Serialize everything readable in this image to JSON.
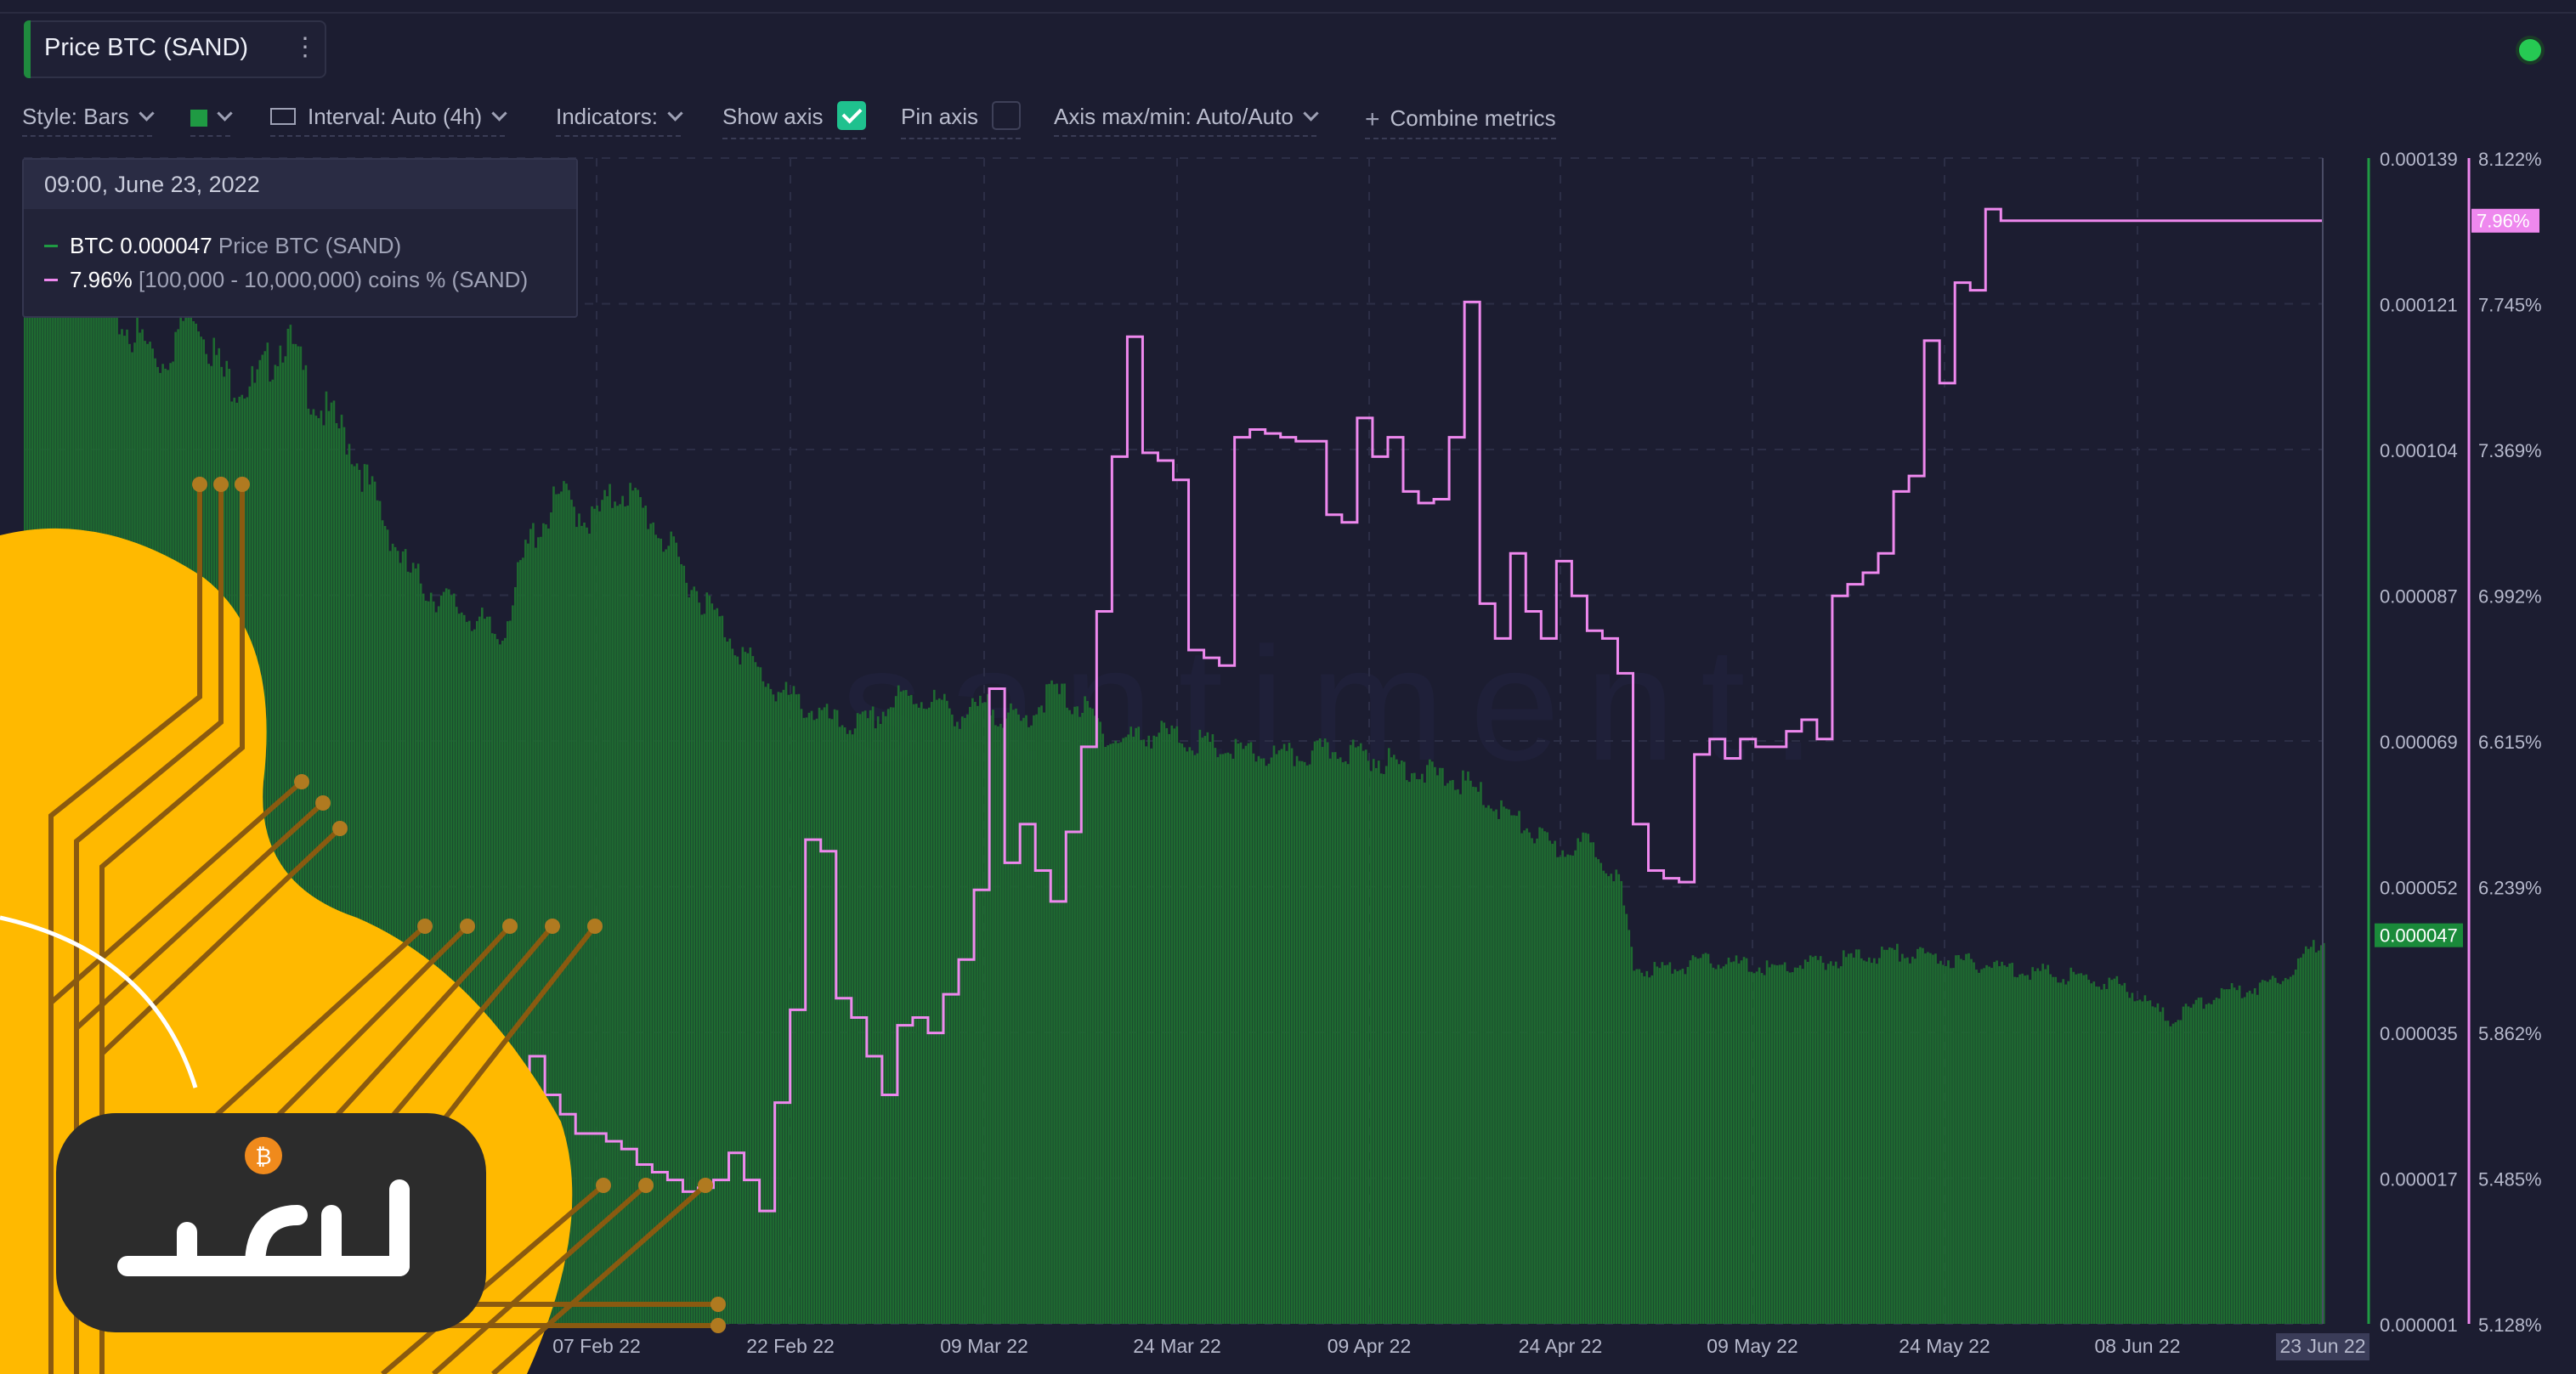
{
  "metric": {
    "label": "Price BTC (SAND)"
  },
  "toolbar": {
    "style_label": "Style: Bars",
    "interval_label": "Interval: Auto (4h)",
    "indicators_label": "Indicators:",
    "show_axis_label": "Show axis",
    "show_axis_checked": true,
    "pin_axis_label": "Pin axis",
    "pin_axis_checked": false,
    "axis_minmax_label": "Axis max/min: Auto/Auto",
    "combine_label": "Combine metrics"
  },
  "colors": {
    "price": "#1e6b30",
    "price_label_bg": "#1a8a3a",
    "supply": "#ee88ee",
    "background": "#1c1d31"
  },
  "tooltip": {
    "date": "09:00, June 23, 2022",
    "rows": [
      {
        "value": "BTC 0.000047",
        "name": "Price BTC (SAND)",
        "color": "#1f9a43"
      },
      {
        "value": "7.96%",
        "name": "[100,000  - 10,000,000) coins % (SAND)",
        "color": "#ee88ee"
      }
    ]
  },
  "watermark": "santiment.",
  "logo_text": "انتخاب",
  "icons": [
    "kebab-icon",
    "chevron-down-icon",
    "ruler-icon",
    "check-icon",
    "plus-icon",
    "status-dot-icon"
  ],
  "chart_data": {
    "type": "bar",
    "x_labels": [
      "07 Feb 22",
      "22 Feb 22",
      "09 Mar 22",
      "24 Mar 22",
      "09 Apr 22",
      "24 Apr 22",
      "09 May 22",
      "24 May 22",
      "08 Jun 22",
      "23 Jun 22"
    ],
    "hover_x_label": "23 Jun 22",
    "y_left": {
      "ticks": [
        "0.000139",
        "0.000121",
        "0.000104",
        "0.000087",
        "0.000069",
        "0.000052",
        "0.000035",
        "0.000017",
        "0.000001"
      ],
      "range": [
        1e-06,
        0.000139
      ],
      "current": "0.000047"
    },
    "y_right": {
      "ticks": [
        "8.122%",
        "7.745%",
        "7.369%",
        "6.992%",
        "6.615%",
        "6.239%",
        "5.862%",
        "5.485%",
        "5.128%"
      ],
      "range": [
        5.108,
        8.122
      ],
      "current": "7.96%"
    },
    "series": [
      {
        "name": "Price BTC (SAND)",
        "kind": "bar",
        "points": [
          [
            "2022-01-24",
            0.000128
          ],
          [
            "2022-01-27",
            0.000126
          ],
          [
            "2022-01-30",
            0.00012
          ],
          [
            "2022-02-02",
            0.000115
          ],
          [
            "2022-02-04",
            0.000122
          ],
          [
            "2022-02-06",
            0.000113
          ],
          [
            "2022-02-08",
            0.000112
          ],
          [
            "2022-02-10",
            0.000118
          ],
          [
            "2022-02-12",
            0.00011
          ],
          [
            "2022-02-14",
            0.000106
          ],
          [
            "2022-02-16",
            9.8e-05
          ],
          [
            "2022-02-18",
            9e-05
          ],
          [
            "2022-02-20",
            8.7e-05
          ],
          [
            "2022-02-22",
            8.5e-05
          ],
          [
            "2022-02-24",
            8.2e-05
          ],
          [
            "2022-02-26",
            9.4e-05
          ],
          [
            "2022-02-28",
            9.9e-05
          ],
          [
            "2022-03-02",
            9.6e-05
          ],
          [
            "2022-03-04",
            0.0001
          ],
          [
            "2022-03-06",
            9.6e-05
          ],
          [
            "2022-03-08",
            9e-05
          ],
          [
            "2022-03-10",
            8.5e-05
          ],
          [
            "2022-03-12",
            8e-05
          ],
          [
            "2022-03-14",
            7.6e-05
          ],
          [
            "2022-03-16",
            7.4e-05
          ],
          [
            "2022-03-18",
            7.2e-05
          ],
          [
            "2022-03-20",
            7.2e-05
          ],
          [
            "2022-03-22",
            7.5e-05
          ],
          [
            "2022-03-24",
            7.5e-05
          ],
          [
            "2022-03-26",
            7.3e-05
          ],
          [
            "2022-03-28",
            7.4e-05
          ],
          [
            "2022-03-30",
            7.2e-05
          ],
          [
            "2022-04-01",
            7.6e-05
          ],
          [
            "2022-04-03",
            7.4e-05
          ],
          [
            "2022-04-05",
            7e-05
          ],
          [
            "2022-04-08",
            7.1e-05
          ],
          [
            "2022-04-12",
            6.9e-05
          ],
          [
            "2022-04-16",
            6.8e-05
          ],
          [
            "2022-04-20",
            6.9e-05
          ],
          [
            "2022-04-24",
            6.7e-05
          ],
          [
            "2022-04-28",
            6.5e-05
          ],
          [
            "2022-05-01",
            6.1e-05
          ],
          [
            "2022-05-04",
            5.7e-05
          ],
          [
            "2022-05-06",
            5.8e-05
          ],
          [
            "2022-05-08",
            5.4e-05
          ],
          [
            "2022-05-09",
            4.3e-05
          ],
          [
            "2022-05-11",
            4.3e-05
          ],
          [
            "2022-05-14",
            4.4e-05
          ],
          [
            "2022-05-18",
            4.3e-05
          ],
          [
            "2022-05-22",
            4.4e-05
          ],
          [
            "2022-05-26",
            4.5e-05
          ],
          [
            "2022-05-30",
            4.4e-05
          ],
          [
            "2022-06-03",
            4.3e-05
          ],
          [
            "2022-06-07",
            4.2e-05
          ],
          [
            "2022-06-10",
            4.1e-05
          ],
          [
            "2022-06-13",
            3.7e-05
          ],
          [
            "2022-06-16",
            4e-05
          ],
          [
            "2022-06-19",
            4.1e-05
          ],
          [
            "2022-06-21",
            4.3e-05
          ],
          [
            "2022-06-23",
            4.7e-05
          ]
        ]
      },
      {
        "name": "[100,000  - 10,000,000) coins % (SAND)",
        "kind": "step-line",
        "points": [
          [
            "2022-01-24",
            5.6
          ],
          [
            "2022-01-26",
            5.75
          ],
          [
            "2022-01-28",
            5.9
          ],
          [
            "2022-01-30",
            6.03
          ],
          [
            "2022-02-01",
            5.9
          ],
          [
            "2022-02-03",
            5.85
          ],
          [
            "2022-02-05",
            6.26
          ],
          [
            "2022-02-07",
            6.25
          ],
          [
            "2022-02-08",
            6.0
          ],
          [
            "2022-02-09",
            5.9
          ],
          [
            "2022-02-10",
            5.7
          ],
          [
            "2022-02-11",
            5.6
          ],
          [
            "2022-02-12",
            5.5
          ],
          [
            "2022-02-13",
            5.7
          ],
          [
            "2022-02-14",
            5.6
          ],
          [
            "2022-02-15",
            5.9
          ],
          [
            "2022-02-16",
            5.8
          ],
          [
            "2022-02-17",
            5.5
          ],
          [
            "2022-02-18",
            5.74
          ],
          [
            "2022-02-19",
            5.7
          ],
          [
            "2022-02-20",
            5.75
          ],
          [
            "2022-02-21",
            5.5
          ],
          [
            "2022-02-22",
            5.6
          ],
          [
            "2022-02-23",
            5.75
          ],
          [
            "2022-02-24",
            5.7
          ],
          [
            "2022-02-25",
            5.5
          ],
          [
            "2022-02-26",
            5.8
          ],
          [
            "2022-02-27",
            5.7
          ],
          [
            "2022-02-28",
            5.65
          ],
          [
            "2022-03-01",
            5.6
          ],
          [
            "2022-03-02",
            5.6
          ],
          [
            "2022-03-03",
            5.58
          ],
          [
            "2022-03-04",
            5.56
          ],
          [
            "2022-03-05",
            5.52
          ],
          [
            "2022-03-06",
            5.5
          ],
          [
            "2022-03-07",
            5.48
          ],
          [
            "2022-03-08",
            5.45
          ],
          [
            "2022-03-09",
            5.46
          ],
          [
            "2022-03-10",
            5.48
          ],
          [
            "2022-03-11",
            5.55
          ],
          [
            "2022-03-12",
            5.48
          ],
          [
            "2022-03-13",
            5.4
          ],
          [
            "2022-03-14",
            5.68
          ],
          [
            "2022-03-15",
            5.92
          ],
          [
            "2022-03-16",
            6.36
          ],
          [
            "2022-03-17",
            6.33
          ],
          [
            "2022-03-18",
            5.95
          ],
          [
            "2022-03-19",
            5.9
          ],
          [
            "2022-03-20",
            5.8
          ],
          [
            "2022-03-21",
            5.7
          ],
          [
            "2022-03-22",
            5.88
          ],
          [
            "2022-03-23",
            5.9
          ],
          [
            "2022-03-24",
            5.86
          ],
          [
            "2022-03-25",
            5.96
          ],
          [
            "2022-03-26",
            6.05
          ],
          [
            "2022-03-27",
            6.23
          ],
          [
            "2022-03-28",
            6.75
          ],
          [
            "2022-03-29",
            6.3
          ],
          [
            "2022-03-30",
            6.4
          ],
          [
            "2022-03-31",
            6.28
          ],
          [
            "2022-04-01",
            6.2
          ],
          [
            "2022-04-02",
            6.38
          ],
          [
            "2022-04-03",
            6.6
          ],
          [
            "2022-04-04",
            6.95
          ],
          [
            "2022-04-05",
            7.35
          ],
          [
            "2022-04-06",
            7.66
          ],
          [
            "2022-04-07",
            7.36
          ],
          [
            "2022-04-08",
            7.34
          ],
          [
            "2022-04-09",
            7.29
          ],
          [
            "2022-04-10",
            6.85
          ],
          [
            "2022-04-11",
            6.83
          ],
          [
            "2022-04-12",
            6.81
          ],
          [
            "2022-04-13",
            7.4
          ],
          [
            "2022-04-14",
            7.42
          ],
          [
            "2022-04-15",
            7.41
          ],
          [
            "2022-04-16",
            7.4
          ],
          [
            "2022-04-17",
            7.39
          ],
          [
            "2022-04-18",
            7.39
          ],
          [
            "2022-04-19",
            7.2
          ],
          [
            "2022-04-20",
            7.18
          ],
          [
            "2022-04-21",
            7.45
          ],
          [
            "2022-04-22",
            7.35
          ],
          [
            "2022-04-23",
            7.4
          ],
          [
            "2022-04-24",
            7.26
          ],
          [
            "2022-04-25",
            7.23
          ],
          [
            "2022-04-26",
            7.24
          ],
          [
            "2022-04-27",
            7.4
          ],
          [
            "2022-04-28",
            7.75
          ],
          [
            "2022-04-29",
            6.97
          ],
          [
            "2022-04-30",
            6.88
          ],
          [
            "2022-05-01",
            7.1
          ],
          [
            "2022-05-02",
            6.95
          ],
          [
            "2022-05-03",
            6.88
          ],
          [
            "2022-05-04",
            7.08
          ],
          [
            "2022-05-05",
            6.99
          ],
          [
            "2022-05-06",
            6.9
          ],
          [
            "2022-05-07",
            6.88
          ],
          [
            "2022-05-08",
            6.79
          ],
          [
            "2022-05-09",
            6.4
          ],
          [
            "2022-05-10",
            6.28
          ],
          [
            "2022-05-11",
            6.26
          ],
          [
            "2022-05-12",
            6.25
          ],
          [
            "2022-05-13",
            6.58
          ],
          [
            "2022-05-14",
            6.62
          ],
          [
            "2022-05-15",
            6.57
          ],
          [
            "2022-05-16",
            6.62
          ],
          [
            "2022-05-17",
            6.6
          ],
          [
            "2022-05-18",
            6.6
          ],
          [
            "2022-05-19",
            6.64
          ],
          [
            "2022-05-20",
            6.67
          ],
          [
            "2022-05-21",
            6.62
          ],
          [
            "2022-05-22",
            6.99
          ],
          [
            "2022-05-23",
            7.02
          ],
          [
            "2022-05-24",
            7.05
          ],
          [
            "2022-05-25",
            7.1
          ],
          [
            "2022-05-26",
            7.26
          ],
          [
            "2022-05-27",
            7.3
          ],
          [
            "2022-05-28",
            7.65
          ],
          [
            "2022-05-29",
            7.54
          ],
          [
            "2022-05-30",
            7.8
          ],
          [
            "2022-05-31",
            7.78
          ],
          [
            "2022-06-01",
            7.99
          ],
          [
            "2022-06-02",
            7.96
          ]
        ]
      }
    ]
  }
}
